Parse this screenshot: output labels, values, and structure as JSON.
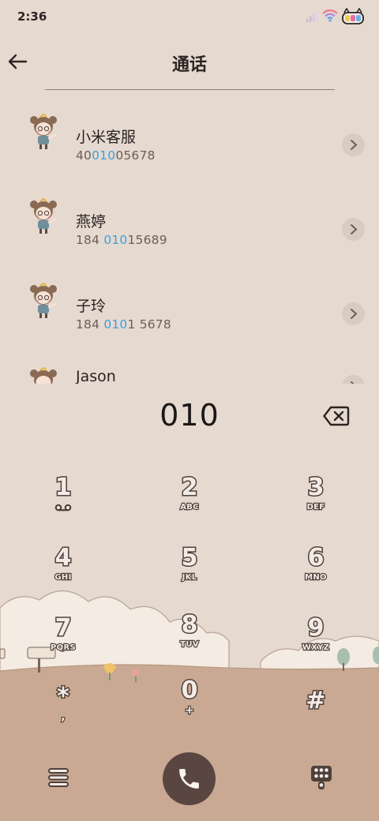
{
  "status": {
    "time": "2:36"
  },
  "header": {
    "title": "通话"
  },
  "contacts": [
    {
      "name": "小米客服",
      "num_pre": "40",
      "num_hl": "010",
      "num_post": "05678"
    },
    {
      "name": "燕婷",
      "num_pre": "184 ",
      "num_hl": "010",
      "num_post": "15689"
    },
    {
      "name": "子玲",
      "num_pre": "184 ",
      "num_hl": "010",
      "num_post": "1 5678"
    },
    {
      "name": "Jason",
      "num_pre": "",
      "num_hl": "",
      "num_post": ""
    }
  ],
  "dialer": {
    "input": "010"
  },
  "keypad": [
    {
      "digit": "1",
      "letters": ""
    },
    {
      "digit": "2",
      "letters": "ABC"
    },
    {
      "digit": "3",
      "letters": "DEF"
    },
    {
      "digit": "4",
      "letters": "GHI"
    },
    {
      "digit": "5",
      "letters": "JKL"
    },
    {
      "digit": "6",
      "letters": "MNO"
    },
    {
      "digit": "7",
      "letters": "PQRS"
    },
    {
      "digit": "8",
      "letters": "TUV"
    },
    {
      "digit": "9",
      "letters": "WXYZ"
    },
    {
      "digit": "*",
      "letters": ","
    },
    {
      "digit": "0",
      "letters": "+"
    },
    {
      "digit": "#",
      "letters": ""
    }
  ],
  "colors": {
    "background": "#e6d9d0",
    "highlight": "#3ca0e0",
    "call_button": "#5a4641",
    "ground": "#c9a993"
  },
  "icons": {
    "back": "back-arrow-icon",
    "chevron": "chevron-right-icon",
    "delete": "backspace-icon",
    "menu": "menu-icon",
    "call": "phone-icon",
    "keypad": "dialpad-icon"
  }
}
